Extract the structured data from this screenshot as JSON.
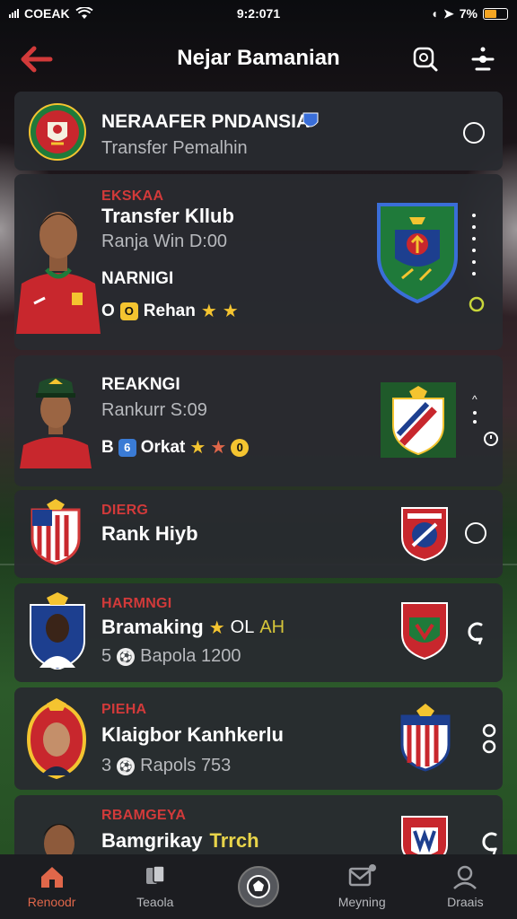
{
  "status_bar": {
    "carrier": "COEAK",
    "time": "9:2:071",
    "battery": "7%"
  },
  "header": {
    "title": "Nejar Bamanian"
  },
  "card_top": {
    "title": "NERAAFER PNDANSIA",
    "subtitle": "Transfer Pemalhin"
  },
  "players": [
    {
      "tag": "Ekskaa",
      "name": "Transfer Kllub",
      "info": "Ranja Win D:00",
      "tag2": "NARNIGI",
      "stat_prefix": "O",
      "stat_coin": "O",
      "stat_text": "Rehan"
    },
    {
      "name": "REAKNGI",
      "info": "Rankurr S:09",
      "stat_prefix": "B",
      "stat_coin": "6",
      "stat_text": "Orkat",
      "stat_coin2": "0"
    },
    {
      "tag": "DIERG",
      "name": "Rank Hiyb"
    },
    {
      "tag": "HARMNGI",
      "name": "Bramaking",
      "extra": "OL",
      "extra2": "AH",
      "count": "5",
      "info": "Bapola 1200"
    },
    {
      "tag": "PIEHA",
      "name": "Klaigbor Kanhkerlu",
      "count": "3",
      "info": "Rapols 753"
    },
    {
      "tag": "RBAMGEYA",
      "name": "Bamgrikay",
      "extra": "Trrch"
    }
  ],
  "nav": [
    {
      "label": "Renoodr",
      "icon": "home-icon"
    },
    {
      "label": "Teaola",
      "icon": "cards-icon"
    },
    {
      "label": "",
      "icon": "ball-icon"
    },
    {
      "label": "Meyning",
      "icon": "inbox-icon"
    },
    {
      "label": "Draais",
      "icon": "profile-icon"
    }
  ],
  "colors": {
    "accent_red": "#d23a3a",
    "nav_active": "#e0674a",
    "gold": "#f4c430"
  }
}
